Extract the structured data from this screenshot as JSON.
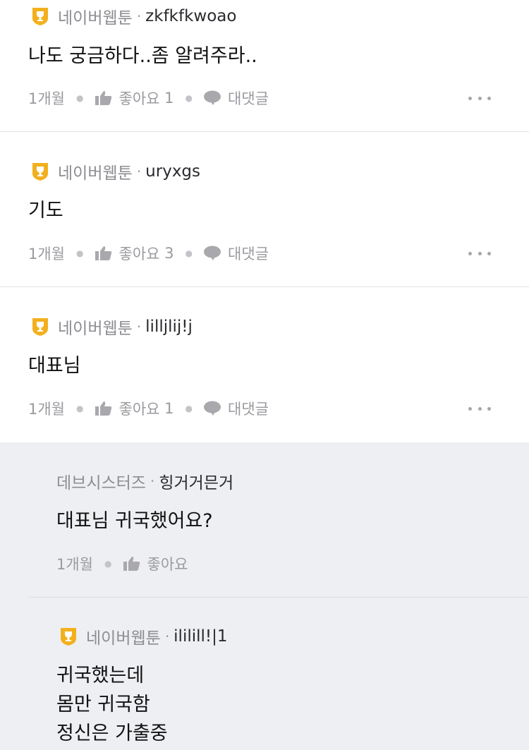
{
  "comments": [
    {
      "group": "네이버웹툰",
      "separator": "·",
      "nickname": "zkfkfkwoao",
      "text": "나도 궁금하다..좀 알려주라..",
      "age": "1개월",
      "like_label": "좋아요",
      "like_count": "1",
      "reply_label": "대댓글"
    },
    {
      "group": "네이버웹툰",
      "separator": "·",
      "nickname": "uryxgs",
      "text": "기도",
      "age": "1개월",
      "like_label": "좋아요",
      "like_count": "3",
      "reply_label": "대댓글"
    },
    {
      "group": "네이버웹툰",
      "separator": "·",
      "nickname": "lilljlij!j",
      "text": "대표님",
      "age": "1개월",
      "like_label": "좋아요",
      "like_count": "1",
      "reply_label": "대댓글"
    }
  ],
  "replies": [
    {
      "group": "데브시스터즈",
      "separator": "·",
      "nickname": "힝거거믄거",
      "text": "대표님 귀국했어요?",
      "age": "1개월",
      "like_label": "좋아요"
    },
    {
      "group": "네이버웹툰",
      "separator": "·",
      "nickname": "ililill!|1",
      "text": "귀국했는데\n몸만 귀국함\n정신은 가출중"
    }
  ],
  "colors": {
    "badge_gold": "#f2b01e",
    "reply_background": "#eeeff3",
    "meta_gray": "#9a9a9f"
  },
  "icons": {
    "badge": "trophy-badge-icon",
    "like": "thumbs-up-icon",
    "reply": "speech-bubble-icon",
    "more": "more-dots-icon"
  }
}
